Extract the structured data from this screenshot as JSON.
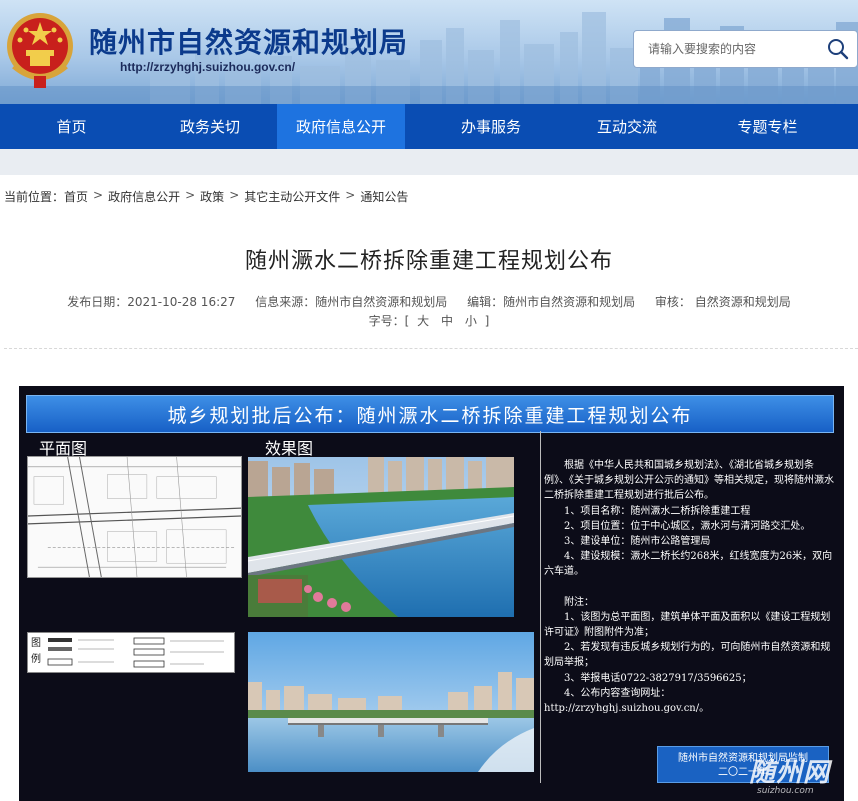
{
  "header": {
    "site_title": "随州市自然资源和规划局",
    "site_url": "http://zrzyhghj.suizhou.gov.cn/",
    "search_placeholder": "请输入要搜索的内容"
  },
  "nav": {
    "items": [
      {
        "label": "首页",
        "active": false
      },
      {
        "label": "政务关切",
        "active": false
      },
      {
        "label": "政府信息公开",
        "active": true
      },
      {
        "label": "办事服务",
        "active": false
      },
      {
        "label": "互动交流",
        "active": false
      },
      {
        "label": "专题专栏",
        "active": false
      }
    ]
  },
  "breadcrumb": {
    "prefix": "当前位置：",
    "items": [
      "首页",
      "政府信息公开",
      "政策",
      "其它主动公开文件",
      "通知公告"
    ],
    "separator": ">"
  },
  "article": {
    "title": "随州㵐水二桥拆除重建工程规划公布",
    "publish_date": "发布日期：2021-10-28 16:27",
    "source": "信息来源：随州市自然资源和规划局",
    "editor": "编辑：随州市自然资源和规划局",
    "reviewer": "审核： 自然资源和规划局",
    "font_size_label": "字号：[",
    "font_size_large": "大",
    "font_size_medium": "中",
    "font_size_small": "小",
    "font_size_end": "]"
  },
  "poster": {
    "banner": "城乡规划批后公布：随州㵐水二桥拆除重建工程规划公布",
    "plan_label": "平面图",
    "render_label": "效果图",
    "legend_label": "图 例",
    "notice_paragraphs": [
      "根据《中华人民共和国城乡规划法》、《湖北省城乡规划条例》、《关于城乡规划公开公示的通知》等相关规定，现将随州㵐水二桥拆除重建工程规划进行批后公布。",
      "1、项目名称：随州㵐水二桥拆除重建工程",
      "2、项目位置：位于中心城区，㵐水河与清河路交汇处。",
      "3、建设单位：随州市公路管理局",
      "4、建设规模：㵐水二桥长约268米，红线宽度为26米，双向六车道。"
    ],
    "notes_title": "附注：",
    "notes": [
      "1、该图为总平面图，建筑单体平面及面积以《建设工程规划许可证》附图附件为准；",
      "2、若发现有违反城乡规划行为的，可向随州市自然资源和规划局举报；",
      "3、举报电话0722-3827917/3596625；",
      "4、公布内容查询网址：",
      "http://zrzyhghj.suizhou.gov.cn/。"
    ],
    "footer_line1": "随州市自然资源和规划局监制",
    "footer_line2": "二〇二一年",
    "watermark": "随州网",
    "watermark_sub": "suizhou.com"
  },
  "colors": {
    "nav_bg": "#0a4db3",
    "nav_active": "#1e73e0",
    "title_blue": "#0b3a8c",
    "poster_banner": "#1760c6"
  }
}
